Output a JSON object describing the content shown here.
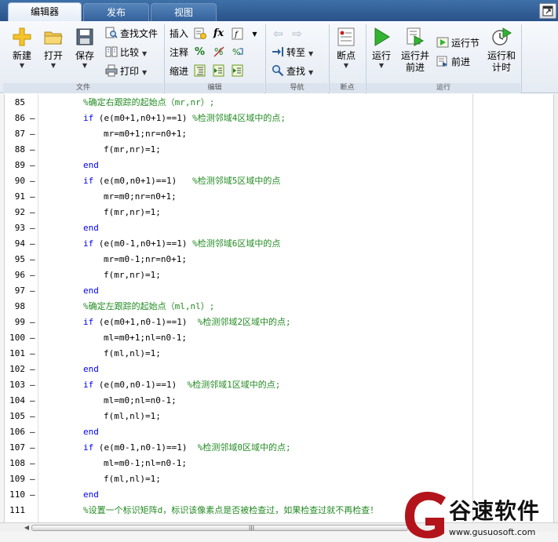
{
  "tabs": [
    {
      "label": "编辑器",
      "active": true
    },
    {
      "label": "发布",
      "active": false
    },
    {
      "label": "视图",
      "active": false
    }
  ],
  "ribbon": {
    "file": {
      "section_label": "文件",
      "new_label": "新建",
      "open_label": "打开",
      "save_label": "保存",
      "find_files_label": "查找文件",
      "compare_label": "比较",
      "print_label": "打印"
    },
    "edit": {
      "section_label": "编辑",
      "insert_label": "插入",
      "comment_label": "注释",
      "indent_label": "缩进",
      "fx_label": "fx"
    },
    "navigate": {
      "section_label": "导航",
      "goto_label": "转至",
      "find_label": "查找"
    },
    "breakpoints": {
      "section_label": "断点",
      "breakpoints_label": "断点"
    },
    "run": {
      "section_label": "运行",
      "run_label": "运行",
      "run_advance_label_1": "运行并",
      "run_advance_label_2": "前进",
      "run_section_label": "运行节",
      "advance_label": "前进",
      "run_time_label_1": "运行和",
      "run_time_label_2": "计时"
    }
  },
  "code_lines": [
    {
      "num": "85",
      "dash": false,
      "indent": 1,
      "parts": [
        {
          "t": "%确定右跟踪的起始点（mr,nr）;",
          "c": "cm"
        }
      ]
    },
    {
      "num": "86",
      "dash": true,
      "indent": 1,
      "parts": [
        {
          "t": "if",
          "c": "kw"
        },
        {
          "t": " (e(m0+1,n0+1)==1) ",
          "c": ""
        },
        {
          "t": "%检测邻域4区域中的点;",
          "c": "cm"
        }
      ]
    },
    {
      "num": "87",
      "dash": true,
      "indent": 2,
      "parts": [
        {
          "t": "mr=m0+1;nr=n0+1;",
          "c": ""
        }
      ]
    },
    {
      "num": "88",
      "dash": true,
      "indent": 2,
      "parts": [
        {
          "t": "f(mr,nr)=1;",
          "c": ""
        }
      ]
    },
    {
      "num": "89",
      "dash": true,
      "indent": 1,
      "parts": [
        {
          "t": "end",
          "c": "kw"
        }
      ]
    },
    {
      "num": "90",
      "dash": true,
      "indent": 1,
      "parts": [
        {
          "t": "if",
          "c": "kw"
        },
        {
          "t": " (e(m0,n0+1)==1)   ",
          "c": ""
        },
        {
          "t": "%检测邻域5区域中的点",
          "c": "cm"
        }
      ]
    },
    {
      "num": "91",
      "dash": true,
      "indent": 2,
      "parts": [
        {
          "t": "mr=m0;nr=n0+1;",
          "c": ""
        }
      ]
    },
    {
      "num": "92",
      "dash": true,
      "indent": 2,
      "parts": [
        {
          "t": "f(mr,nr)=1;",
          "c": ""
        }
      ]
    },
    {
      "num": "93",
      "dash": true,
      "indent": 1,
      "parts": [
        {
          "t": "end",
          "c": "kw"
        }
      ]
    },
    {
      "num": "94",
      "dash": true,
      "indent": 1,
      "parts": [
        {
          "t": "if",
          "c": "kw"
        },
        {
          "t": " (e(m0-1,n0+1)==1) ",
          "c": ""
        },
        {
          "t": "%检测邻域6区域中的点",
          "c": "cm"
        }
      ]
    },
    {
      "num": "95",
      "dash": true,
      "indent": 2,
      "parts": [
        {
          "t": "mr=m0-1;nr=n0+1;",
          "c": ""
        }
      ]
    },
    {
      "num": "96",
      "dash": true,
      "indent": 2,
      "parts": [
        {
          "t": "f(mr,nr)=1;",
          "c": ""
        }
      ]
    },
    {
      "num": "97",
      "dash": true,
      "indent": 1,
      "parts": [
        {
          "t": "end",
          "c": "kw"
        }
      ]
    },
    {
      "num": "98",
      "dash": false,
      "indent": 1,
      "parts": [
        {
          "t": "%确定左跟踪的起始点（ml,nl）;",
          "c": "cm"
        }
      ]
    },
    {
      "num": "99",
      "dash": true,
      "indent": 1,
      "parts": [
        {
          "t": "if",
          "c": "kw"
        },
        {
          "t": " (e(m0+1,n0-1)==1)  ",
          "c": ""
        },
        {
          "t": "%检测邻域2区域中的点;",
          "c": "cm"
        }
      ]
    },
    {
      "num": "100",
      "dash": true,
      "indent": 2,
      "parts": [
        {
          "t": "ml=m0+1;nl=n0-1;",
          "c": ""
        }
      ]
    },
    {
      "num": "101",
      "dash": true,
      "indent": 2,
      "parts": [
        {
          "t": "f(ml,nl)=1;",
          "c": ""
        }
      ]
    },
    {
      "num": "102",
      "dash": true,
      "indent": 1,
      "parts": [
        {
          "t": "end",
          "c": "kw"
        }
      ]
    },
    {
      "num": "103",
      "dash": true,
      "indent": 1,
      "parts": [
        {
          "t": "if",
          "c": "kw"
        },
        {
          "t": " (e(m0,n0-1)==1)  ",
          "c": ""
        },
        {
          "t": "%检测邻域1区域中的点;",
          "c": "cm"
        }
      ]
    },
    {
      "num": "104",
      "dash": true,
      "indent": 2,
      "parts": [
        {
          "t": "ml=m0;nl=n0-1;",
          "c": ""
        }
      ]
    },
    {
      "num": "105",
      "dash": true,
      "indent": 2,
      "parts": [
        {
          "t": "f(ml,nl)=1;",
          "c": ""
        }
      ]
    },
    {
      "num": "106",
      "dash": true,
      "indent": 1,
      "parts": [
        {
          "t": "end",
          "c": "kw"
        }
      ]
    },
    {
      "num": "107",
      "dash": true,
      "indent": 1,
      "parts": [
        {
          "t": "if",
          "c": "kw"
        },
        {
          "t": " (e(m0-1,n0-1)==1)  ",
          "c": ""
        },
        {
          "t": "%检测邻域0区域中的点;",
          "c": "cm"
        }
      ]
    },
    {
      "num": "108",
      "dash": true,
      "indent": 2,
      "parts": [
        {
          "t": "ml=m0-1;nl=n0-1;",
          "c": ""
        }
      ]
    },
    {
      "num": "109",
      "dash": true,
      "indent": 2,
      "parts": [
        {
          "t": "f(ml,nl)=1;",
          "c": ""
        }
      ]
    },
    {
      "num": "110",
      "dash": true,
      "indent": 1,
      "parts": [
        {
          "t": "end",
          "c": "kw"
        }
      ]
    },
    {
      "num": "111",
      "dash": false,
      "indent": 1,
      "parts": [
        {
          "t": "%设置一个标识矩阵d，标识该像素点是否被检查过，如果检查过就不再检查！",
          "c": "cm"
        }
      ]
    }
  ],
  "scrollbar": {
    "grip": "III"
  },
  "watermark": {
    "brand": "谷速软件",
    "url": "www.gusuosoft.com"
  },
  "colors": {
    "keyword": "#0000ff",
    "comment": "#228b22",
    "tab_bar": "#2a5288",
    "watermark_red": "#b3141b"
  }
}
